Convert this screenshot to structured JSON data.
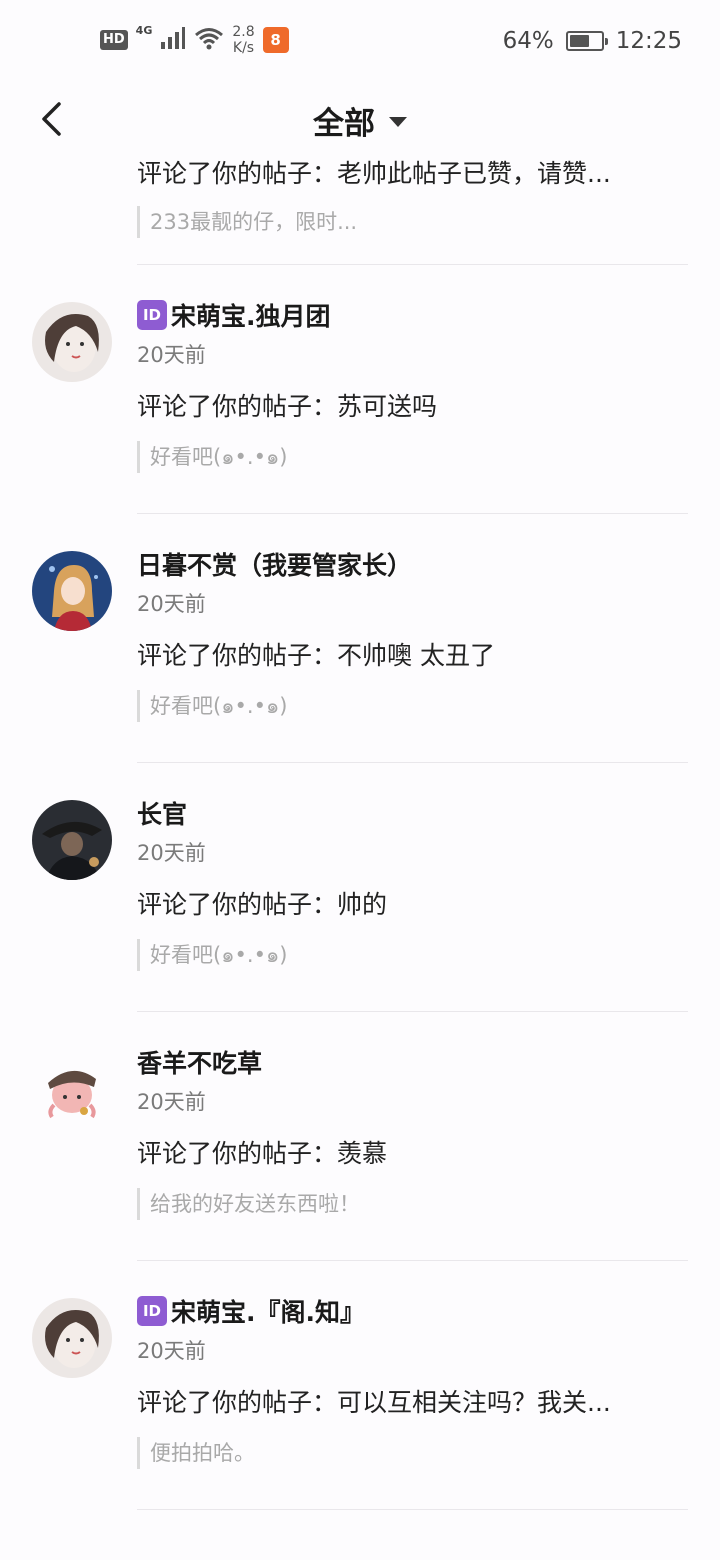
{
  "status_bar": {
    "hd": "HD",
    "network": "4G",
    "speed_value": "2.8",
    "speed_unit": "K/s",
    "app_badge": "8",
    "battery_percent": "64%",
    "battery_level": 0.64,
    "time": "12:25"
  },
  "header": {
    "title": "全部",
    "back_icon": "chevron-left-icon",
    "dropdown_icon": "caret-down-icon"
  },
  "notifications": [
    {
      "partial": true,
      "comment": "评论了你的帖子：老帅此帖子已赞，请赞...",
      "quote": "233最靓的仔，限时..."
    },
    {
      "name": "宋萌宝.独月团",
      "id_badge": "ID",
      "time": "20天前",
      "comment": "评论了你的帖子：苏可送吗",
      "quote": "好看吧(๑•.•๑)",
      "avatar_colors": [
        "#e9e3e1",
        "#5b4a44"
      ]
    },
    {
      "name": "日暮不赏（我要管家长）",
      "time": "20天前",
      "comment": "评论了你的帖子：不帅噢 太丑了",
      "quote": "好看吧(๑•.•๑)",
      "avatar_colors": [
        "#2a4f8a",
        "#d9a25d"
      ]
    },
    {
      "name": "长官",
      "time": "20天前",
      "comment": "评论了你的帖子：帅的",
      "quote": "好看吧(๑•.•๑)",
      "avatar_colors": [
        "#2b2f36",
        "#8a6a52"
      ]
    },
    {
      "name": "香羊不吃草",
      "time": "20天前",
      "comment": "评论了你的帖子：羡慕",
      "quote": "给我的好友送东西啦！",
      "avatar_colors": [
        "#fdfcfe",
        "#e9a2a6"
      ]
    },
    {
      "name": "宋萌宝.『阁.知』",
      "id_badge": "ID",
      "time": "20天前",
      "comment": "评论了你的帖子：可以互相关注吗？我关...",
      "quote": "便拍拍哈。",
      "avatar_colors": [
        "#e9e3e1",
        "#5b4a44"
      ]
    }
  ]
}
